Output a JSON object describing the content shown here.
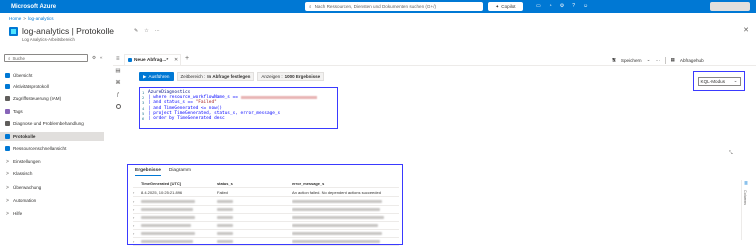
{
  "topbar": {
    "brand": "Microsoft Azure",
    "search_placeholder": "Nach Ressourcen, Diensten und Dokumenten suchen (G+/)",
    "copilot_label": "Copilot"
  },
  "breadcrumb": {
    "home": "Home",
    "sep": ">",
    "current": "log-analytics"
  },
  "header": {
    "title": "log-analytics | Protokolle",
    "subtitle": "Log Analytics-Arbeitsbereich"
  },
  "sidebar": {
    "search_label": "Suche",
    "collapse_glyph": "«",
    "items": [
      {
        "label": "Übersicht",
        "color": "#0078d4",
        "chevron": ""
      },
      {
        "label": "Aktivitätsprotokoll",
        "color": "#0078d4",
        "chevron": ""
      },
      {
        "label": "Zugriffssteuerung (IAM)",
        "color": "#605e5c",
        "chevron": ""
      },
      {
        "label": "Tags",
        "color": "#8764b8",
        "chevron": ""
      },
      {
        "label": "Diagnose und Problembehandlung",
        "color": "#605e5c",
        "chevron": ""
      },
      {
        "label": "Protokolle",
        "color": "#0078d4",
        "chevron": ""
      },
      {
        "label": "Ressourcenschnellansicht",
        "color": "#0078d4",
        "chevron": ""
      },
      {
        "label": "Einstellungen",
        "color": "",
        "chevron": ">"
      },
      {
        "label": "Klassisch",
        "color": "",
        "chevron": ">"
      },
      {
        "label": "Überwachung",
        "color": "",
        "chevron": ">"
      },
      {
        "label": "Automation",
        "color": "",
        "chevron": ">"
      },
      {
        "label": "Hilfe",
        "color": "",
        "chevron": ">"
      }
    ]
  },
  "tabs": {
    "query_tab": "Neue Abfrag...*",
    "add_glyph": "+",
    "save_label": "Speichern",
    "more_glyph": "···",
    "hub_label": "Abfragehub"
  },
  "toolbar": {
    "run_label": "Ausführen",
    "timerange_prefix": "Zeitbereich :",
    "timerange_value": "In Abfrage festlegen",
    "show_prefix": "Anzeigen :",
    "show_value": "1000 Ergebnisse",
    "mode_label": "KQL-Modus"
  },
  "query": {
    "line1": "AzureDiagnostics",
    "line2_a": "| where resource_workflowName_s == ",
    "line3_a": "| and status_s == ",
    "line3_b": "\"Failed\"",
    "line4": "| and TimeGenerated <= now()",
    "line5": "| project TimeGenerated, status_s, error_message_s",
    "line6": "| order by TimeGenerated desc",
    "line_numbers": [
      "1",
      "2",
      "3",
      "4",
      "5",
      "6"
    ]
  },
  "results": {
    "tab_results": "Ergebnisse",
    "tab_chart": "Diagramm",
    "columns": [
      "TimeGenerated [UTC]",
      "status_s",
      "error_message_s"
    ],
    "first_row": {
      "time": "8.4.2025, 10:25:21.896",
      "status": "Failed",
      "message": "An action failed. No dependent actions succeeded"
    },
    "side_label": "Columns"
  }
}
